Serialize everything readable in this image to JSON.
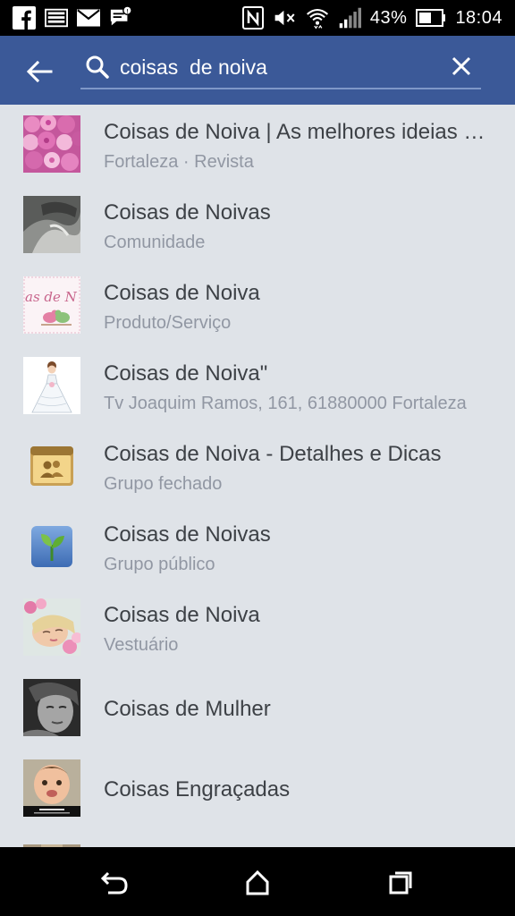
{
  "status_bar": {
    "battery": "43%",
    "time": "18:04",
    "icons": [
      "facebook-icon",
      "image-icon",
      "mail-icon",
      "message-icon",
      "nfc-icon",
      "mute-icon",
      "wifi-icon",
      "signal-icon",
      "battery-icon"
    ]
  },
  "search": {
    "query": "coisas  de noiva",
    "back_icon": "back-arrow-icon",
    "clear_icon": "close-icon"
  },
  "results": [
    {
      "title": "Coisas de Noiva | As melhores ideias para seu casamento",
      "subtitle": "Fortaleza · Revista",
      "thumb": "pink-roses-photo"
    },
    {
      "title": "Coisas de Noivas",
      "subtitle": "Comunidade",
      "thumb": "wedding-dress-photo"
    },
    {
      "title": "Coisas de Noiva",
      "subtitle": "Produto/Serviço",
      "thumb": "love-birds-logo"
    },
    {
      "title": "Coisas de Noiva\"",
      "subtitle": "Tv Joaquim Ramos, 161, 61880000 Fortaleza",
      "thumb": "bride-illustration"
    },
    {
      "title": "Coisas de Noiva - Detalhes e Dicas",
      "subtitle": "Grupo fechado",
      "thumb": "closed-group-icon"
    },
    {
      "title": "Coisas de Noivas",
      "subtitle": "Grupo público",
      "thumb": "public-group-icon"
    },
    {
      "title": "Coisas de Noiva",
      "subtitle": "Vestuário",
      "thumb": "bride-flowers-photo"
    },
    {
      "title": "Coisas de Mulher",
      "subtitle": "",
      "thumb": "woman-portrait-photo"
    },
    {
      "title": "Coisas Engraçadas",
      "subtitle": "",
      "thumb": "baby-photo"
    }
  ],
  "nav_bar": {
    "icons": [
      "back-nav-icon",
      "home-nav-icon",
      "recents-nav-icon"
    ]
  }
}
